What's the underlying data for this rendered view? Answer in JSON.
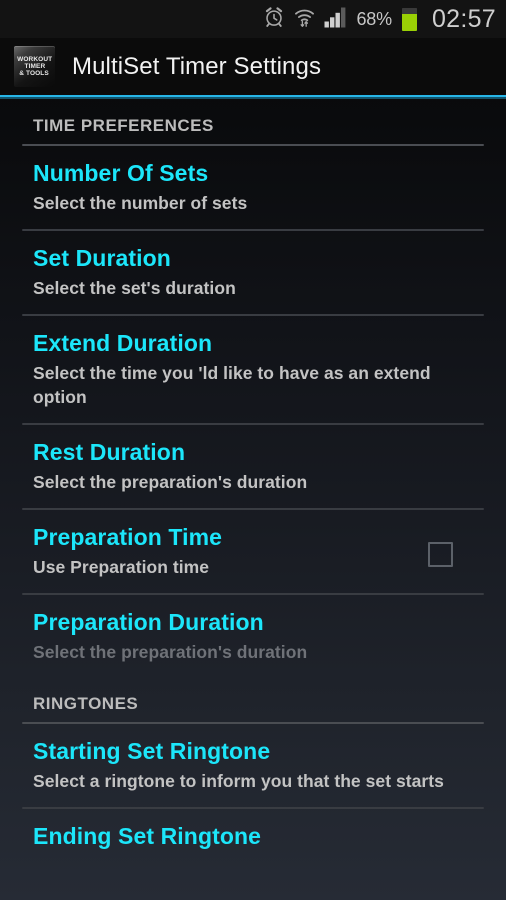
{
  "status_bar": {
    "alarm_icon": "alarm-clock-icon",
    "wifi_icon": "wifi-transfer-icon",
    "signal_icon": "signal-bars-icon",
    "battery_percent": "68%",
    "battery_icon": "battery-icon",
    "clock": "02:57",
    "battery_color": "#9ad005",
    "text_color": "#c6c6c6"
  },
  "action_bar": {
    "app_icon_name": "workout-timer-tools-app-icon",
    "app_icon_lines": [
      "WORKOUT",
      "TIMER",
      "& TOOLS"
    ],
    "title": "MultiSet Timer Settings",
    "accent_color": "#27b6e8"
  },
  "theme": {
    "accent_cyan": "#1ce6fa",
    "summary_gray": "#c3c3c3",
    "disabled_gray": "#6f7278",
    "section_header_gray": "#bcbcbc",
    "divider_gray": "#4a4d52"
  },
  "sections": [
    {
      "header": "TIME PREFERENCES",
      "items": [
        {
          "title": "Number Of Sets",
          "summary": "Select the number of sets",
          "widget": "none",
          "enabled": true
        },
        {
          "title": "Set Duration",
          "summary": "Select the set's duration",
          "widget": "none",
          "enabled": true
        },
        {
          "title": "Extend Duration",
          "summary": "Select the time you 'ld like to have as an extend option",
          "widget": "none",
          "enabled": true
        },
        {
          "title": "Rest Duration",
          "summary": "Select the preparation's duration",
          "widget": "none",
          "enabled": true
        },
        {
          "title": "Preparation Time",
          "summary": "Use Preparation time",
          "widget": "checkbox",
          "checked": false,
          "enabled": true
        },
        {
          "title": "Preparation Duration",
          "summary": "Select the preparation's duration",
          "widget": "none",
          "enabled": false
        }
      ]
    },
    {
      "header": "RINGTONES",
      "items": [
        {
          "title": "Starting Set Ringtone",
          "summary": "Select a ringtone to inform you that the set starts",
          "widget": "none",
          "enabled": true
        },
        {
          "title": "Ending Set Ringtone",
          "summary": "",
          "widget": "none",
          "enabled": true
        }
      ]
    }
  ]
}
